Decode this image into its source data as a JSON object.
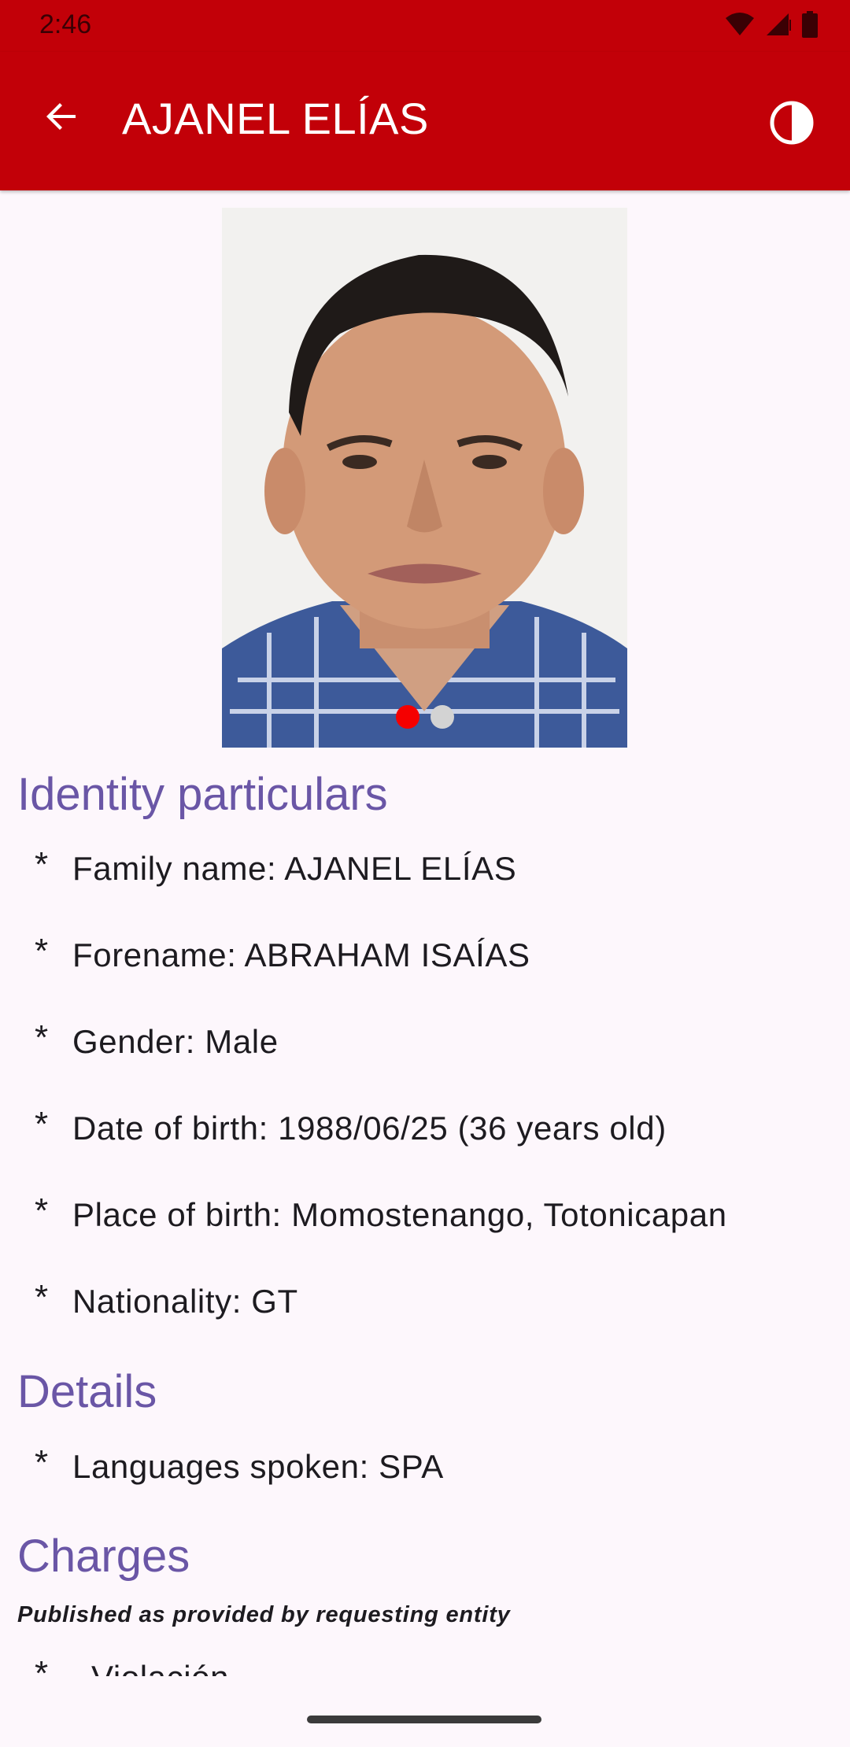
{
  "status_bar": {
    "time": "2:46",
    "icons": [
      "wifi-icon",
      "cellular-signal-icon",
      "battery-icon"
    ]
  },
  "app_bar": {
    "title": "AJANEL ELÍAS",
    "back_icon": "arrow-back-icon",
    "theme_icon": "contrast-icon",
    "background_color": "#c20008"
  },
  "photo": {
    "pager_dots": 2,
    "active_index": 0,
    "active_color": "#f50000",
    "inactive_color": "#d3d3d3"
  },
  "identity": {
    "heading": "Identity particulars",
    "items": [
      "Family name: AJANEL ELÍAS",
      "Forename: ABRAHAM ISAÍAS",
      "Gender: Male",
      "Date of birth: 1988/06/25 (36 years old)",
      "Place of birth: Momostenango, Totonicapan",
      "Nationality: GT"
    ]
  },
  "details": {
    "heading": "Details",
    "items": [
      "Languages spoken: SPA"
    ]
  },
  "charges": {
    "heading": "Charges",
    "note": "Published as provided by requesting entity",
    "items": [
      "Violación"
    ]
  },
  "bullet_symbol": "*",
  "colors": {
    "heading": "#6a56a6",
    "background": "#fdf7fc",
    "text": "#1d1b20"
  }
}
